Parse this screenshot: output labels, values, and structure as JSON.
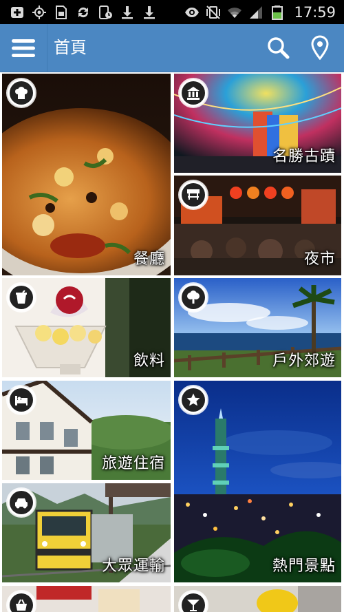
{
  "status_bar": {
    "time": "17:59",
    "icons": [
      "add-box-icon",
      "gps-icon",
      "sim-card-icon",
      "sync-icon",
      "screenshot-icon",
      "download-icon",
      "download-icon",
      "eye-icon",
      "vibrate-mute-icon",
      "wifi-icon",
      "signal-icon",
      "battery-icon"
    ]
  },
  "action_bar": {
    "title": "首頁",
    "menu_icon": "hamburger-menu-icon",
    "search_icon": "search-icon",
    "location_icon": "location-pin-icon",
    "color": "#4b87c2"
  },
  "categories": [
    {
      "label": "餐廳",
      "icon": "chef-hat-icon"
    },
    {
      "label": "名勝古蹟",
      "icon": "temple-icon"
    },
    {
      "label": "夜市",
      "icon": "market-stall-icon"
    },
    {
      "label": "飲料",
      "icon": "drink-cup-icon"
    },
    {
      "label": "戶外郊遊",
      "icon": "tree-icon"
    },
    {
      "label": "旅遊住宿",
      "icon": "bed-icon"
    },
    {
      "label": "熱門景點",
      "icon": "star-icon"
    },
    {
      "label": "大眾運輸",
      "icon": "car-icon"
    },
    {
      "label": "",
      "icon": "shopping-basket-icon"
    },
    {
      "label": "",
      "icon": "cocktail-icon"
    }
  ]
}
